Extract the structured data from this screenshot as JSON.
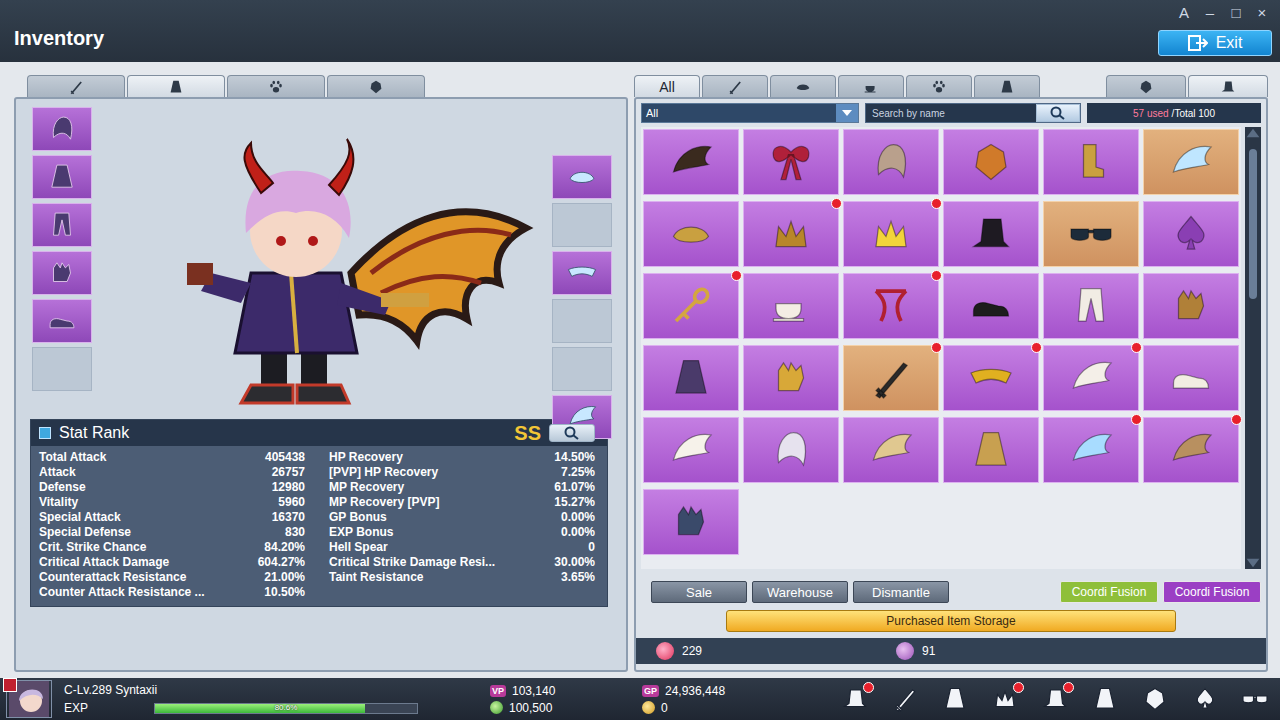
{
  "window": {
    "title": "Inventory",
    "controls": [
      "A",
      "–",
      "□",
      "×"
    ],
    "exit": "Exit"
  },
  "equip_tabs": [
    {
      "selected": false
    },
    {
      "selected": true
    },
    {
      "selected": false
    },
    {
      "selected": false
    }
  ],
  "left_slots": [
    {
      "filled": true
    },
    {
      "filled": true
    },
    {
      "filled": true
    },
    {
      "filled": true
    },
    {
      "filled": true
    },
    {
      "filled": false
    }
  ],
  "right_slots": [
    {
      "filled": true
    },
    {
      "filled": false
    },
    {
      "filled": true
    },
    {
      "filled": false
    },
    {
      "filled": false
    },
    {
      "filled": true
    }
  ],
  "stat_rank": {
    "title": "Stat Rank",
    "rank": "SS",
    "left": [
      {
        "label": "Total Attack",
        "value": "405438"
      },
      {
        "label": "Attack",
        "value": "26757"
      },
      {
        "label": "Defense",
        "value": "12980"
      },
      {
        "label": "Vitality",
        "value": "5960"
      },
      {
        "label": "Special Attack",
        "value": "16370"
      },
      {
        "label": "Special Defense",
        "value": "830"
      },
      {
        "label": "Crit. Strike Chance",
        "value": "84.20%"
      },
      {
        "label": "Critical Attack Damage",
        "value": "604.27%"
      },
      {
        "label": "Counterattack Resistance",
        "value": "21.00%"
      },
      {
        "label": "Counter Attack Resistance ...",
        "value": "10.50%"
      }
    ],
    "right": [
      {
        "label": "HP Recovery",
        "value": "14.50%"
      },
      {
        "label": "[PVP] HP Recovery",
        "value": "7.25%"
      },
      {
        "label": "MP Recovery",
        "value": "61.07%"
      },
      {
        "label": "MP Recovery [PVP]",
        "value": "15.27%"
      },
      {
        "label": "GP Bonus",
        "value": "0.00%"
      },
      {
        "label": "EXP Bonus",
        "value": "0.00%"
      },
      {
        "label": "Hell Spear",
        "value": "0"
      },
      {
        "label": "Critical Strike Damage Resi...",
        "value": "30.00%"
      },
      {
        "label": "Taint Resistance",
        "value": "3.65%"
      }
    ]
  },
  "bag_tabs": {
    "all": {
      "label": "All",
      "selected": true
    },
    "icons": [
      {
        "selected": false
      },
      {
        "selected": false
      },
      {
        "selected": false
      },
      {
        "selected": false
      },
      {
        "selected": false
      }
    ],
    "side": [
      {
        "selected": false
      },
      {
        "selected": true
      }
    ]
  },
  "filter": {
    "dropdown": "All",
    "search_placeholder": "Search by name",
    "used": "57 used",
    "total": "/Total 100"
  },
  "items": [
    {
      "rare": false,
      "new": false
    },
    {
      "rare": false,
      "new": false
    },
    {
      "rare": false,
      "new": false
    },
    {
      "rare": false,
      "new": false
    },
    {
      "rare": false,
      "new": false
    },
    {
      "rare": true,
      "new": false
    },
    {
      "rare": false,
      "new": false
    },
    {
      "rare": false,
      "new": true
    },
    {
      "rare": false,
      "new": true
    },
    {
      "rare": false,
      "new": false
    },
    {
      "rare": true,
      "new": false
    },
    {
      "rare": false,
      "new": false
    },
    {
      "rare": false,
      "new": true
    },
    {
      "rare": false,
      "new": false
    },
    {
      "rare": false,
      "new": true
    },
    {
      "rare": false,
      "new": false
    },
    {
      "rare": false,
      "new": false
    },
    {
      "rare": false,
      "new": false
    },
    {
      "rare": false,
      "new": false
    },
    {
      "rare": false,
      "new": false
    },
    {
      "rare": true,
      "new": true
    },
    {
      "rare": false,
      "new": true
    },
    {
      "rare": false,
      "new": true
    },
    {
      "rare": false,
      "new": false
    },
    {
      "rare": false,
      "new": false
    },
    {
      "rare": false,
      "new": false
    },
    {
      "rare": false,
      "new": false
    },
    {
      "rare": false,
      "new": false
    },
    {
      "rare": false,
      "new": true
    },
    {
      "rare": false,
      "new": true
    },
    {
      "rare": false,
      "new": false
    }
  ],
  "actions": [
    "Sale",
    "Warehouse",
    "Dismantle"
  ],
  "fusion": [
    {
      "label": "Coordi Fusion",
      "color": "#8fbf3a"
    },
    {
      "label": "Coordi Fusion",
      "color": "#9b3fc4"
    }
  ],
  "storage": "Purchased Item Storage",
  "counters": [
    "229",
    "91"
  ],
  "player": {
    "name": "C-Lv.289 Syntaxii",
    "exp_label": "EXP",
    "exp_level": 0.8,
    "exp_reading": "80.6%"
  },
  "currencies": [
    {
      "kind": "badge",
      "badge": "VP",
      "value": "103,140"
    },
    {
      "kind": "badge",
      "badge": "GP",
      "value": "24,936,448"
    },
    {
      "kind": "coin",
      "badge": "",
      "value": "100,500"
    },
    {
      "kind": "gold",
      "badge": "",
      "value": "0"
    }
  ],
  "menu": [
    {
      "new": true
    },
    {
      "new": false
    },
    {
      "new": false
    },
    {
      "new": true
    },
    {
      "new": true
    },
    {
      "new": false
    },
    {
      "new": false
    },
    {
      "new": false
    },
    {
      "new": false
    }
  ]
}
